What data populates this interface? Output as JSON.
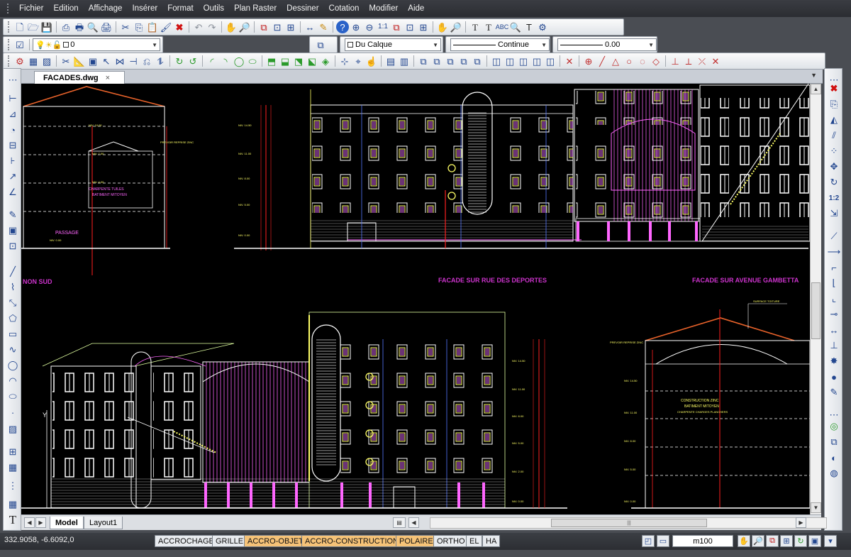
{
  "menu": [
    "Fichier",
    "Edition",
    "Affichage",
    "Insérer",
    "Format",
    "Outils",
    "Plan Raster",
    "Dessiner",
    "Cotation",
    "Modifier",
    "Aide"
  ],
  "properties": {
    "layer_value": "0",
    "color_value": "Du Calque",
    "linetype_value": "Continue",
    "lineweight_value": "0.00"
  },
  "document": {
    "tab_title": "FACADES.dwg",
    "tab_close": "×"
  },
  "drawing": {
    "label_left": "NON SUD",
    "label_center": "FACADE SUR RUE DES DEPORTES",
    "label_right": "FACADE SUR AVENUE GAMBETTA",
    "label_passage": "PASSAGE"
  },
  "layout_tabs": {
    "model": "Model",
    "layout1": "Layout1"
  },
  "status": {
    "coords": "332.9058, -6.6092,0",
    "buttons": [
      {
        "label": "ACCROCHAGE",
        "on": false
      },
      {
        "label": "GRILLE",
        "on": false
      },
      {
        "label": "ACCRO-OBJET",
        "on": true
      },
      {
        "label": "ACCRO-CONSTRUCTION",
        "on": true
      },
      {
        "label": "POLAIRE",
        "on": true
      },
      {
        "label": "ORTHO",
        "on": false
      },
      {
        "label": "EL",
        "on": false
      },
      {
        "label": "HA",
        "on": false
      }
    ],
    "scale": "m100"
  },
  "colors": {
    "canvas_bg": "#000000",
    "building_line": "#ffffff",
    "window_yellow": "#ffff66",
    "accent_magenta": "#ff66ff",
    "roof_orange": "#e8622a",
    "label_purple": "#cc33cc",
    "dim_red": "#ff2020",
    "active_status": "#f6c378"
  }
}
